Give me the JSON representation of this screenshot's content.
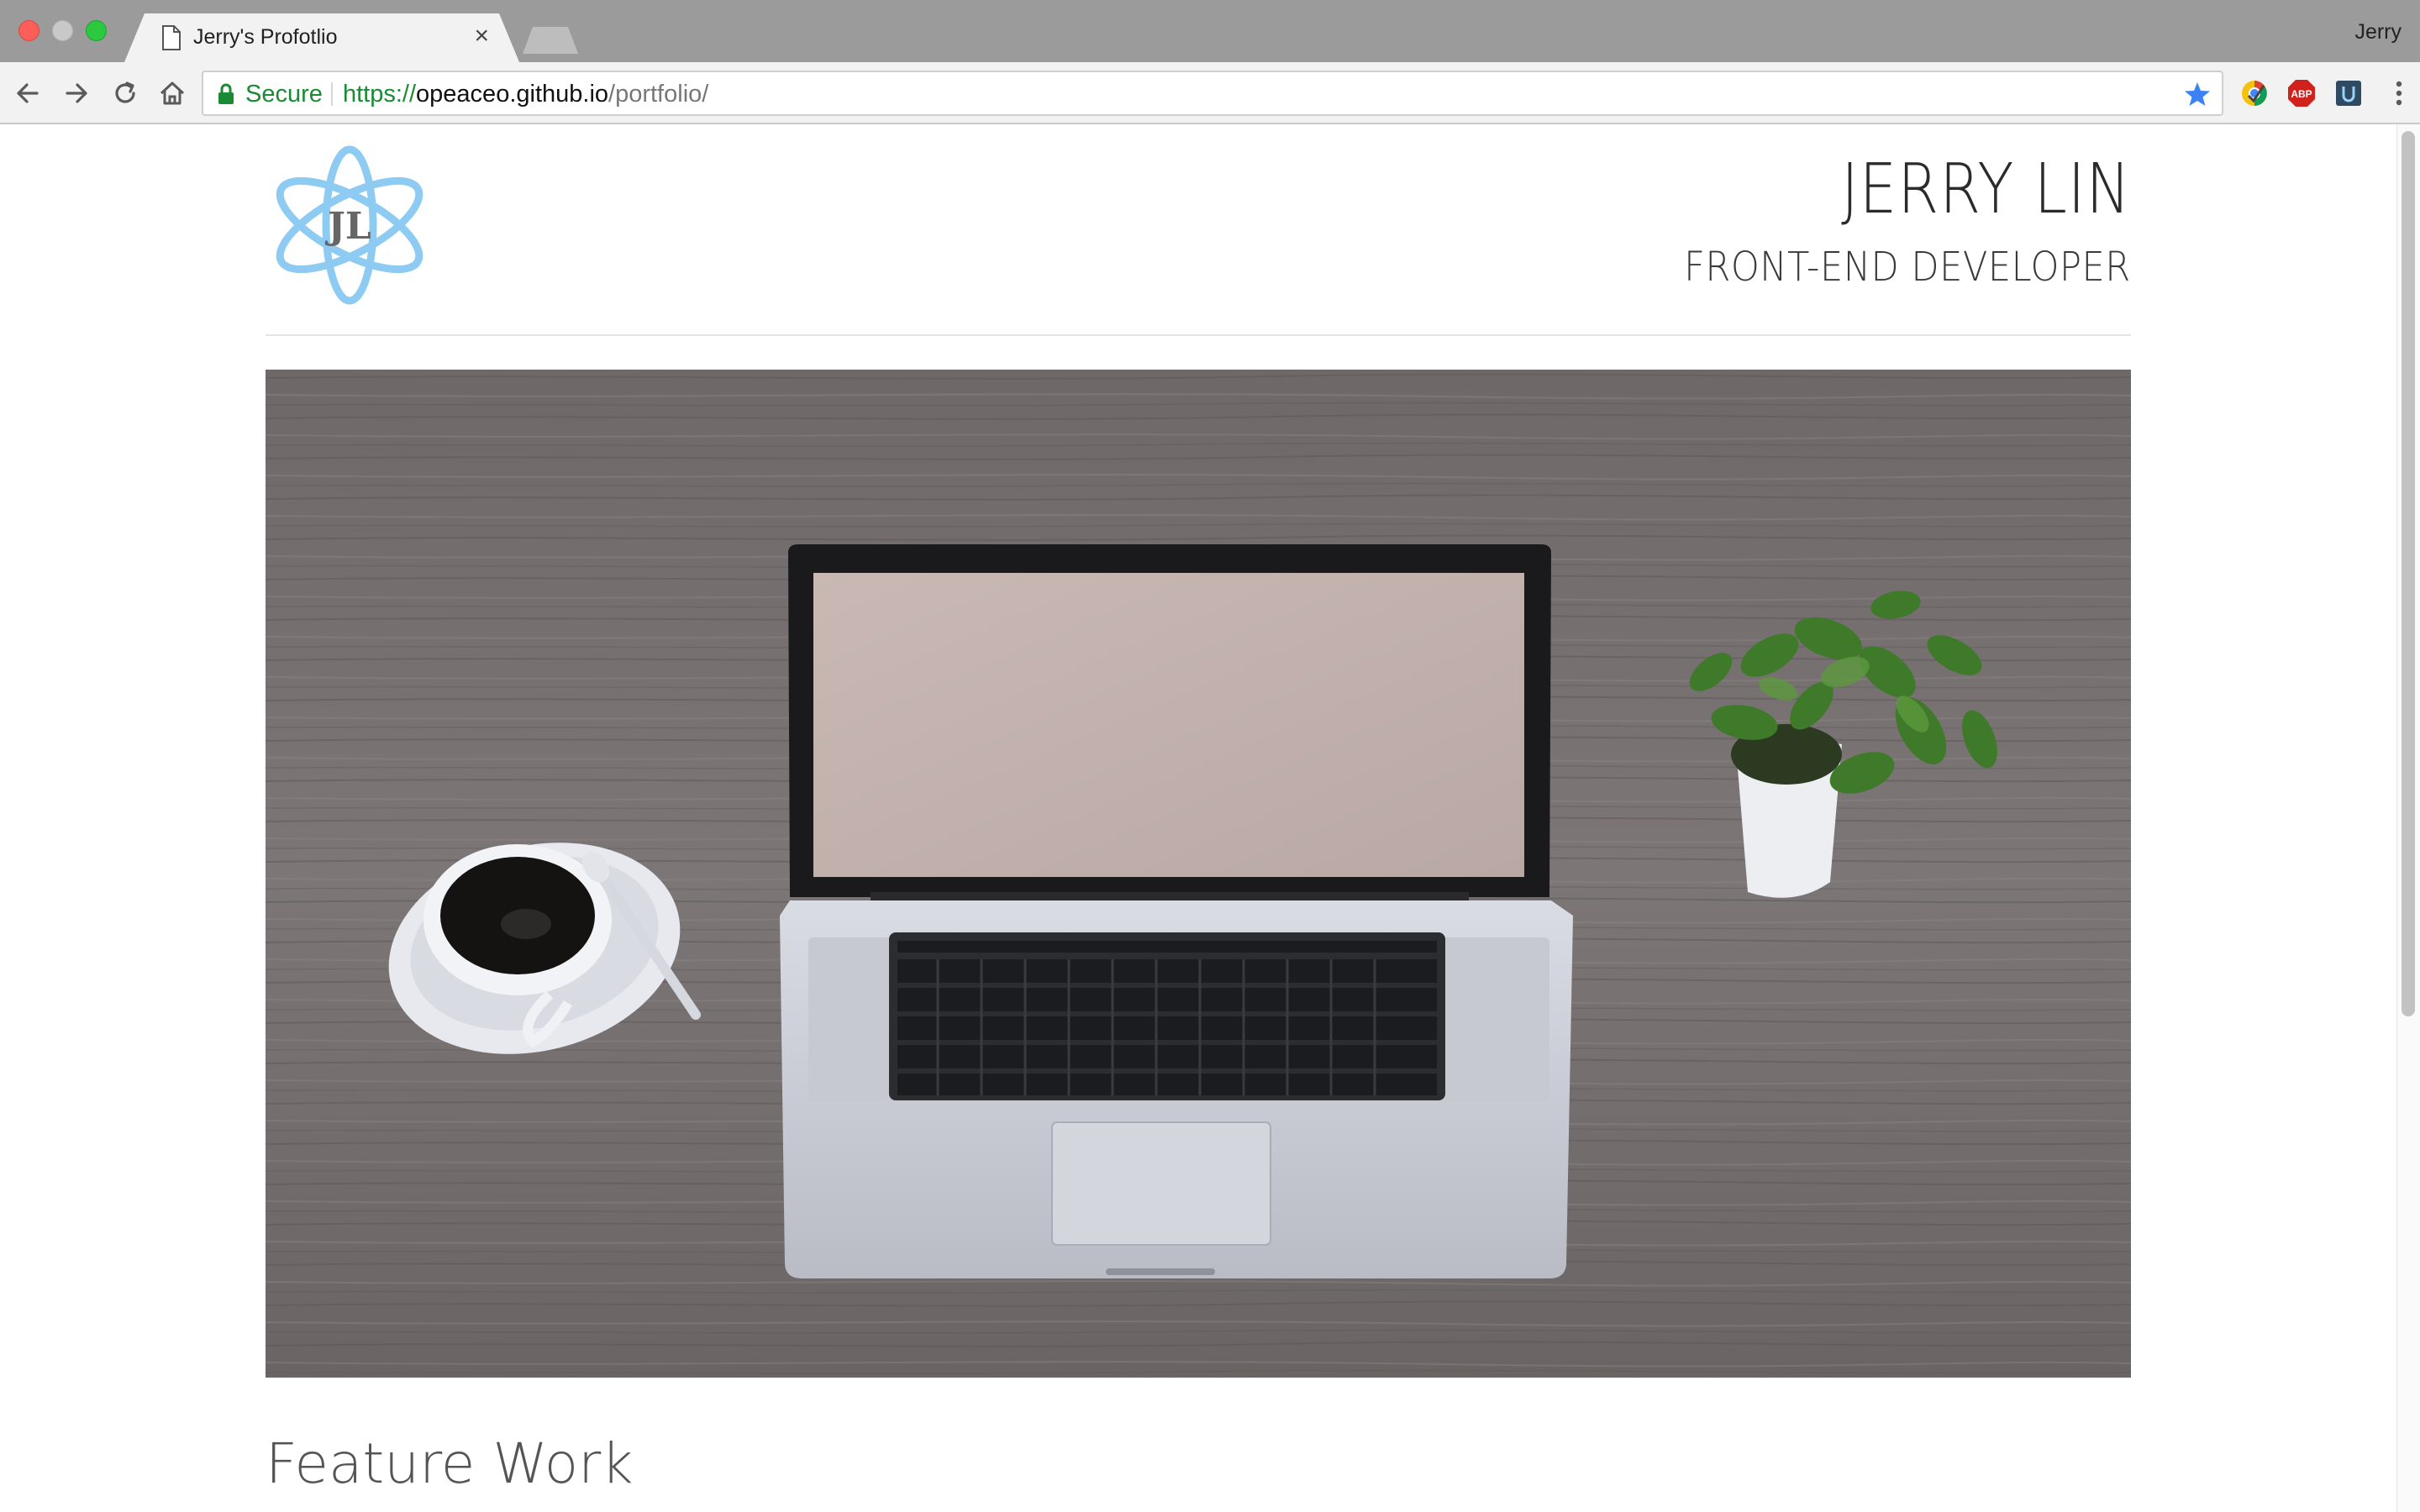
{
  "browser": {
    "tab_title": "Jerry's Profotlio",
    "tab_close": "×",
    "profile_name": "Jerry",
    "security_label": "Secure",
    "url_scheme": "https://",
    "url_host": "opeaceo.github.io",
    "url_path": "/portfolio/",
    "extensions": [
      "chrome-extension-icon",
      "adblock-plus-icon",
      "tab-extension-icon"
    ]
  },
  "header": {
    "logo_initials": "JL",
    "name": "JERRY LIN",
    "role": "FRONT-END DEVELOPER"
  },
  "hero": {
    "description": "Laptop on wooden desk with coffee cup and potted plant"
  },
  "sections": {
    "feature_title": "Feature Work"
  },
  "colors": {
    "secure_green": "#1a8a34",
    "logo_blue": "#8ecbf2",
    "bookmark_star": "#3b82f6"
  }
}
